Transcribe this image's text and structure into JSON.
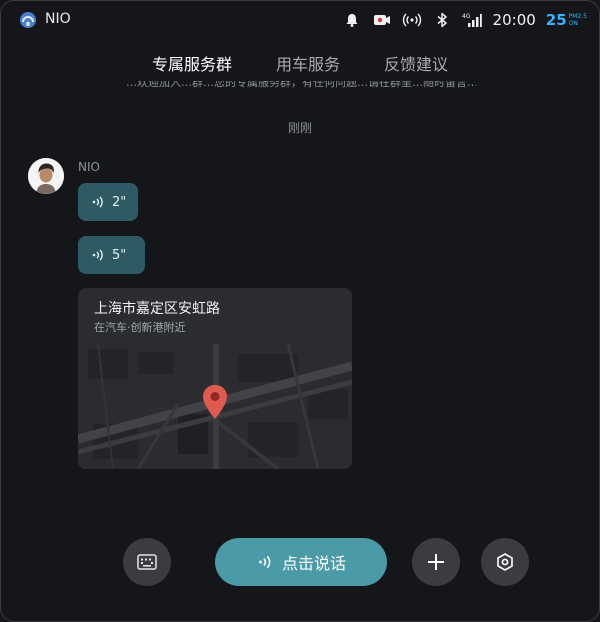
{
  "status_bar": {
    "app_name": "NIO",
    "time": "20:00",
    "aqi": {
      "value": "25",
      "label_top": "PM2.5",
      "label_bottom": "ON"
    },
    "icons": [
      "bell-icon",
      "camera-record-icon",
      "wireless-signal-icon",
      "bluetooth-icon",
      "4g-signal-icon"
    ],
    "network_type": "4G"
  },
  "tabs": [
    {
      "label": "专属服务群",
      "active": true
    },
    {
      "label": "用车服务",
      "active": false
    },
    {
      "label": "反馈建议",
      "active": false
    }
  ],
  "chat": {
    "cut_off_text": "…欢迎加入…群…您的专属服务群，有任何问题…请在群里…随时留言…",
    "timestamp": "刚刚",
    "sender": "NIO",
    "voice_messages": [
      {
        "duration": "2\""
      },
      {
        "duration": "5\""
      }
    ],
    "location": {
      "title": "上海市嘉定区安虹路",
      "subtitle": "在汽车·创新港附近"
    }
  },
  "input_bar": {
    "talk_label": "点击说话"
  },
  "colors": {
    "background": "#151619",
    "voice_bubble": "#2d5a63",
    "talk_button": "#4a9aa8",
    "accent": "#34b3ff",
    "pin": "#e05a50"
  }
}
